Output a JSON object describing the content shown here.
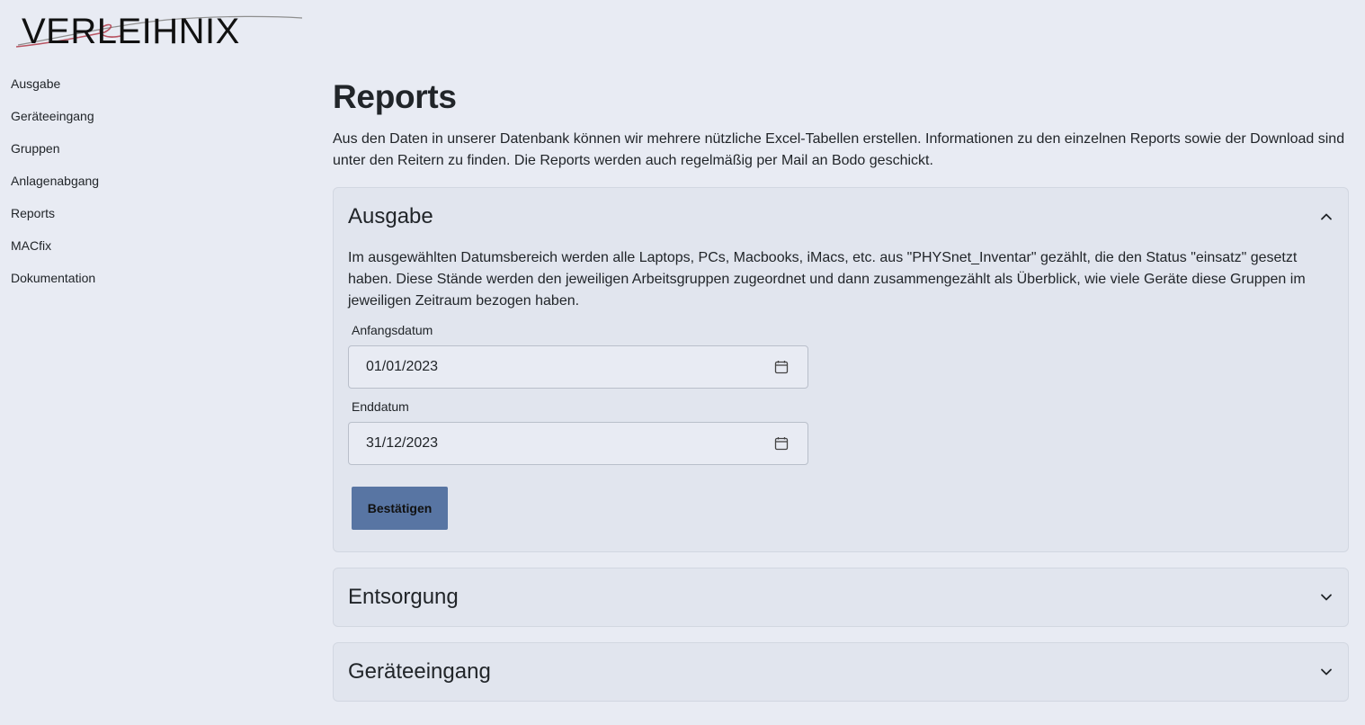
{
  "app": {
    "logo_text": "VERLEIHNIX"
  },
  "sidebar": {
    "items": [
      {
        "label": "Ausgabe"
      },
      {
        "label": "Geräteeingang"
      },
      {
        "label": "Gruppen"
      },
      {
        "label": "Anlagenabgang"
      },
      {
        "label": "Reports"
      },
      {
        "label": "MACfix"
      },
      {
        "label": "Dokumentation"
      }
    ]
  },
  "main": {
    "title": "Reports",
    "intro": "Aus den Daten in unserer Datenbank können wir mehrere nützliche Excel-Tabellen erstellen. Informationen zu den einzelnen Reports sowie der Download sind unter den Reitern zu finden. Die Reports werden auch regelmäßig per Mail an Bodo geschickt.",
    "accordion": [
      {
        "title": "Ausgabe",
        "expanded": true,
        "description": "Im ausgewählten Datumsbereich werden alle Laptops, PCs, Macbooks, iMacs, etc. aus \"PHYSnet_Inventar\" gezählt, die den Status \"einsatz\" gesetzt haben. Diese Stände werden den jeweiligen Arbeitsgruppen zugeordnet und dann zusammengezählt als Überblick, wie viele Geräte diese Gruppen im jeweiligen Zeitraum bezogen haben.",
        "start_label": "Anfangsdatum",
        "start_value": "01/01/2023",
        "end_label": "Enddatum",
        "end_value": "31/12/2023",
        "button_label": "Bestätigen"
      },
      {
        "title": "Entsorgung",
        "expanded": false
      },
      {
        "title": "Geräteeingang",
        "expanded": false
      }
    ]
  },
  "colors": {
    "background": "#e8ebf3",
    "panel": "#e1e5ee",
    "button": "#5875a3",
    "logo_swoosh": "#b03a48"
  },
  "icons": [
    "chevron-up-icon",
    "chevron-down-icon",
    "calendar-icon"
  ]
}
